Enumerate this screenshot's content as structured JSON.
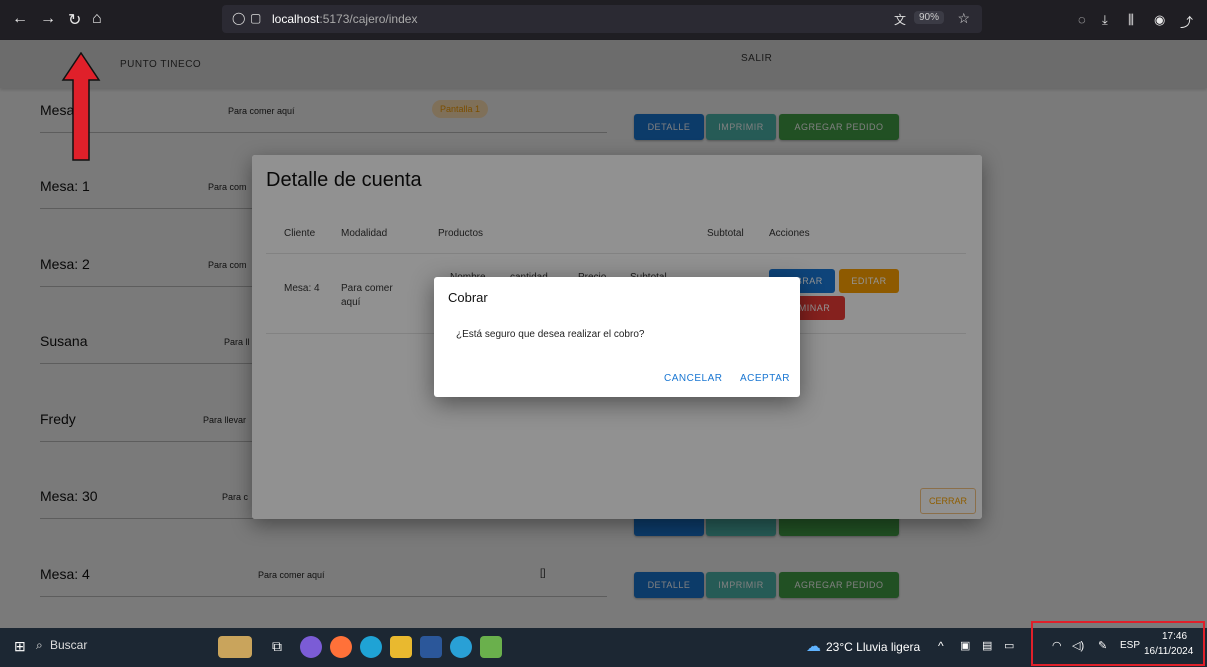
{
  "browser": {
    "url_host": "localhost",
    "url_path": ":5173/cajero/index",
    "zoom": "90%"
  },
  "appbar": {
    "brand": "PUNTO TINECO",
    "logout": "SALIR"
  },
  "rows": [
    {
      "name": "Mesa: 2",
      "modality": "Para comer aquí",
      "badge": "Pantalla 1"
    },
    {
      "name": "Mesa: 1",
      "modality": "Para com"
    },
    {
      "name": "Mesa: 2",
      "modality": "Para com"
    },
    {
      "name": "Susana",
      "modality": "Para ll"
    },
    {
      "name": "Fredy",
      "modality": "Para llevar"
    },
    {
      "name": "Mesa: 30",
      "modality": "Para c"
    },
    {
      "name": "Mesa: 4",
      "modality": "Para comer aquí",
      "products": "[]"
    }
  ],
  "row_buttons": {
    "detail": "DETALLE",
    "print": "IMPRIMIR",
    "add": "AGREGAR PEDIDO"
  },
  "detail_dialog": {
    "title": "Detalle de cuenta",
    "headers": [
      "Cliente",
      "Modalidad",
      "Productos",
      "Subtotal",
      "Acciones"
    ],
    "sub_headers": [
      "Nombre",
      "cantidad",
      "Precio",
      "Subtotal"
    ],
    "client": "Mesa: 4",
    "modality": "Para comer aquí",
    "actions": {
      "charge": "COBRAR",
      "edit": "EDITAR",
      "delete": "ELIMINAR"
    },
    "close": "CERRAR"
  },
  "confirm_dialog": {
    "title": "Cobrar",
    "message": "¿Está seguro que desea realizar el cobro?",
    "cancel": "CANCELAR",
    "accept": "ACEPTAR"
  },
  "taskbar": {
    "search": "Buscar",
    "weather": "23°C Lluvia ligera",
    "lang": "ESP",
    "time": "17:46",
    "date": "16/11/2024"
  },
  "colors": {
    "primary": "#1976d2",
    "teal": "#4db6ac",
    "green": "#43a047",
    "orange": "#f59c00",
    "red": "#e53935",
    "annotation": "#e0202a"
  }
}
